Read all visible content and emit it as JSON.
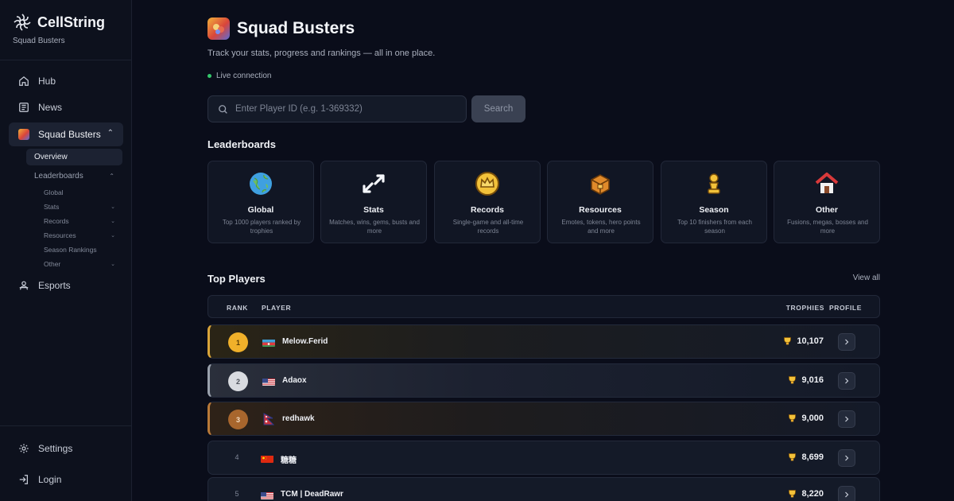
{
  "brand": {
    "name": "CellString",
    "subtitle": "Squad Busters"
  },
  "sidebar": {
    "nav": [
      {
        "label": "Hub",
        "icon": "home-icon"
      },
      {
        "label": "News",
        "icon": "newspaper-icon"
      },
      {
        "label": "Squad Busters",
        "icon": "squad-busters-icon"
      },
      {
        "label": "Esports",
        "icon": "people-icon"
      }
    ],
    "sub": [
      {
        "label": "Overview"
      },
      {
        "label": "Leaderboards"
      }
    ],
    "subsub": [
      {
        "label": "Global"
      },
      {
        "label": "Stats"
      },
      {
        "label": "Records"
      },
      {
        "label": "Resources"
      },
      {
        "label": "Season Rankings"
      },
      {
        "label": "Other"
      }
    ],
    "footer": [
      {
        "label": "Settings",
        "icon": "gear-icon"
      },
      {
        "label": "Login",
        "icon": "login-icon"
      }
    ]
  },
  "header": {
    "title": "Squad Busters",
    "tagline": "Track your stats, progress and rankings — all in one place.",
    "status": "Live connection",
    "status_color": "#34c76b"
  },
  "search": {
    "placeholder": "Enter Player ID (e.g. 1-369332)",
    "value": "",
    "button": "Search"
  },
  "leaderboards": {
    "title": "Leaderboards",
    "cards": [
      {
        "title": "Global",
        "desc": "Top 1000 players ranked by trophies",
        "icon": "globe-icon"
      },
      {
        "title": "Stats",
        "desc": "Matches, wins, gems, busts and more",
        "icon": "arrows-icon"
      },
      {
        "title": "Records",
        "desc": "Single-game and all-time records",
        "icon": "crown-icon"
      },
      {
        "title": "Resources",
        "desc": "Emotes, tokens, hero points and more",
        "icon": "chest-icon"
      },
      {
        "title": "Season",
        "desc": "Top 10 finishers from each season",
        "icon": "chess-piece-icon"
      },
      {
        "title": "Other",
        "desc": "Fusions, megas, bosses and more",
        "icon": "house-icon"
      }
    ]
  },
  "top_players": {
    "title": "Top Players",
    "view_all": "View all",
    "columns": {
      "rank": "RANK",
      "player": "PLAYER",
      "trophies": "TROPHIES",
      "profile": "PROFILE"
    },
    "rows": [
      {
        "rank": "1",
        "name": "Melow.Ferid",
        "flag": "flag-azerbaijan",
        "trophies": "10,107"
      },
      {
        "rank": "2",
        "name": "Adaox",
        "flag": "flag-usa",
        "trophies": "9,016"
      },
      {
        "rank": "3",
        "name": "redhawk",
        "flag": "flag-nepal",
        "trophies": "9,000"
      },
      {
        "rank": "4",
        "name": "糖糖",
        "flag": "flag-china",
        "trophies": "8,699"
      },
      {
        "rank": "5",
        "name": "TCM | DeadRawr",
        "flag": "flag-usa",
        "trophies": "8,220"
      }
    ]
  }
}
